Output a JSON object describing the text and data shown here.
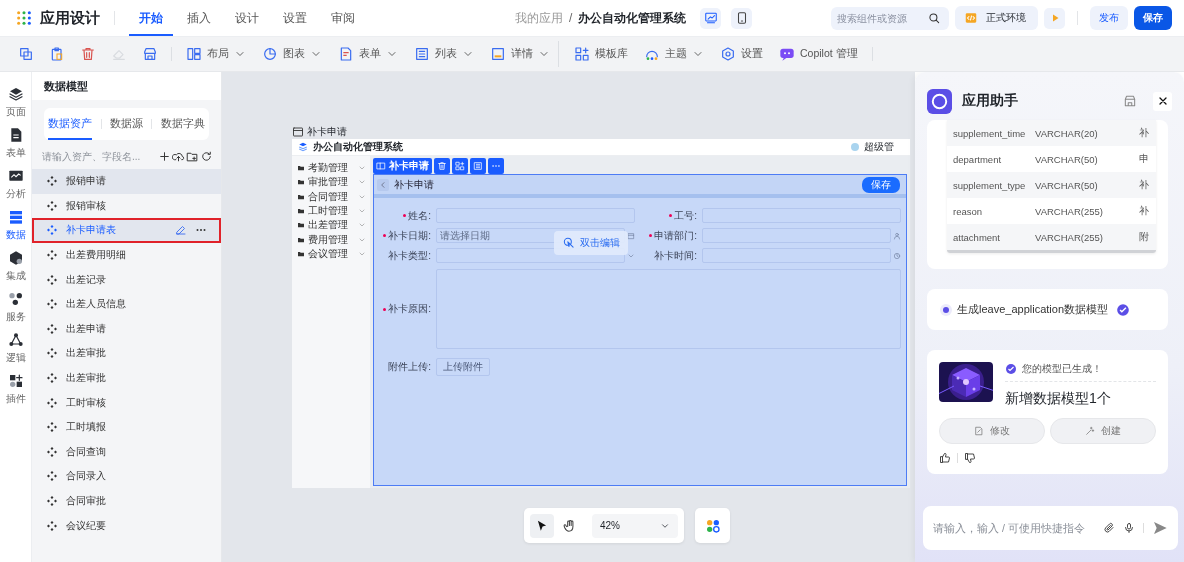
{
  "app": {
    "title": "应用设计"
  },
  "menu_tabs": [
    {
      "label": "开始",
      "selected": true
    },
    {
      "label": "插入",
      "selected": false
    },
    {
      "label": "设计",
      "selected": false
    },
    {
      "label": "设置",
      "selected": false
    },
    {
      "label": "审阅",
      "selected": false
    }
  ],
  "breadcrumb": {
    "parent": "我的应用",
    "separator": "/",
    "current": "办公自动化管理系统"
  },
  "devices": [
    {
      "kind": "desktop",
      "selected": true
    },
    {
      "kind": "tablet",
      "selected": false
    }
  ],
  "search": {
    "placeholder": "搜索组件或资源"
  },
  "environment": {
    "label": "正式环境"
  },
  "publish_button": "发布",
  "save_button": "保存",
  "toolbar": {
    "icon_buttons": [
      {
        "kind": "copy",
        "disabled": false
      },
      {
        "kind": "paste",
        "disabled": false
      },
      {
        "kind": "delete",
        "disabled": false
      },
      {
        "kind": "erase",
        "disabled": true
      },
      {
        "kind": "store",
        "disabled": false
      }
    ],
    "menus": [
      {
        "kind": "layout",
        "label": "布局",
        "dropdown": true,
        "divider_before": false
      },
      {
        "kind": "chart",
        "label": "图表",
        "dropdown": true,
        "divider_before": false
      },
      {
        "kind": "form",
        "label": "表单",
        "dropdown": true,
        "divider_before": false
      },
      {
        "kind": "list",
        "label": "列表",
        "dropdown": true,
        "divider_before": false
      },
      {
        "kind": "detail",
        "label": "详情",
        "dropdown": true,
        "divider_before": false
      },
      {
        "kind": "template",
        "label": "模板库",
        "dropdown": false,
        "divider_before": true
      },
      {
        "kind": "theme",
        "label": "主题",
        "dropdown": true,
        "divider_before": false
      },
      {
        "kind": "settings",
        "label": "设置",
        "dropdown": false,
        "divider_before": false
      },
      {
        "kind": "copilot",
        "label": "Copilot 管理",
        "dropdown": false,
        "divider_before": false
      }
    ]
  },
  "rail": [
    {
      "kind": "pages",
      "label": "页面",
      "selected": false
    },
    {
      "kind": "form",
      "label": "表单",
      "selected": false
    },
    {
      "kind": "analysis",
      "label": "分析",
      "selected": false
    },
    {
      "kind": "data",
      "label": "数据",
      "selected": true
    },
    {
      "kind": "integration",
      "label": "集成",
      "selected": false
    },
    {
      "kind": "service",
      "label": "服务",
      "selected": false
    },
    {
      "kind": "logic",
      "label": "逻辑",
      "selected": false
    },
    {
      "kind": "plugin",
      "label": "插件",
      "selected": false
    }
  ],
  "data_panel": {
    "title": "数据模型",
    "tabs": [
      {
        "label": "数据资产",
        "selected": true
      },
      {
        "label": "数据源",
        "selected": false
      },
      {
        "label": "数据字典",
        "selected": false
      }
    ],
    "search": {
      "placeholder": "请输入资产、字段名..."
    },
    "items": [
      {
        "label": "报销申请",
        "hovered": true,
        "selected": false
      },
      {
        "label": "报销审核",
        "hovered": false,
        "selected": false
      },
      {
        "label": "补卡申请表",
        "hovered": false,
        "selected": true
      },
      {
        "label": "出差费用明细",
        "hovered": false,
        "selected": false
      },
      {
        "label": "出差记录",
        "hovered": false,
        "selected": false
      },
      {
        "label": "出差人员信息",
        "hovered": false,
        "selected": false
      },
      {
        "label": "出差申请",
        "hovered": false,
        "selected": false
      },
      {
        "label": "出差审批",
        "hovered": false,
        "selected": false
      },
      {
        "label": "出差审批",
        "hovered": false,
        "selected": false
      },
      {
        "label": "工时审核",
        "hovered": false,
        "selected": false
      },
      {
        "label": "工时填报",
        "hovered": false,
        "selected": false
      },
      {
        "label": "合同查询",
        "hovered": false,
        "selected": false
      },
      {
        "label": "合同录入",
        "hovered": false,
        "selected": false
      },
      {
        "label": "合同审批",
        "hovered": false,
        "selected": false
      },
      {
        "label": "会议纪要",
        "hovered": false,
        "selected": false
      }
    ]
  },
  "canvas": {
    "page_title": "补卡申请",
    "preview": {
      "app_name": "办公自动化管理系统",
      "user": "超级管",
      "menu": [
        "考勤管理",
        "审批管理",
        "合同管理",
        "工时管理",
        "出差管理",
        "费用管理",
        "会议管理"
      ],
      "selection_label": "补卡申请",
      "form_title": "补卡申请",
      "form_save": "保存",
      "fields_left": [
        {
          "label": "姓名:",
          "required": true
        },
        {
          "label": "补卡日期:",
          "required": true,
          "placeholder": "请选择日期"
        },
        {
          "label": "补卡类型:",
          "required": false
        }
      ],
      "fields_right": [
        {
          "label": "工号:",
          "required": true
        },
        {
          "label": "申请部门:",
          "required": true
        },
        {
          "label": "补卡时间:",
          "required": false
        }
      ],
      "textarea": {
        "label": "补卡原因:",
        "required": true
      },
      "attachment": {
        "label": "附件上传:",
        "button": "上传附件"
      },
      "hint": "双击编辑"
    },
    "zoom": "42%"
  },
  "assistant": {
    "title": "应用助手",
    "table_rows": [
      {
        "name": "supplement_time",
        "type": "VARCHAR(20)",
        "comment": "补"
      },
      {
        "name": "department",
        "type": "VARCHAR(50)",
        "comment": "申"
      },
      {
        "name": "supplement_type",
        "type": "VARCHAR(50)",
        "comment": "补"
      },
      {
        "name": "reason",
        "type": "VARCHAR(255)",
        "comment": "补"
      },
      {
        "name": "attachment",
        "type": "VARCHAR(255)",
        "comment": "附"
      }
    ],
    "step": {
      "label": "生成leave_application数据模型",
      "done": true
    },
    "result": {
      "status": "您的模型已生成！",
      "headline": "新增数据模型1个",
      "buttons": [
        {
          "kind": "edit",
          "label": "修改"
        },
        {
          "kind": "create",
          "label": "创建"
        }
      ]
    },
    "input": {
      "placeholder": "请输入，输入 / 可使用快捷指令"
    }
  }
}
